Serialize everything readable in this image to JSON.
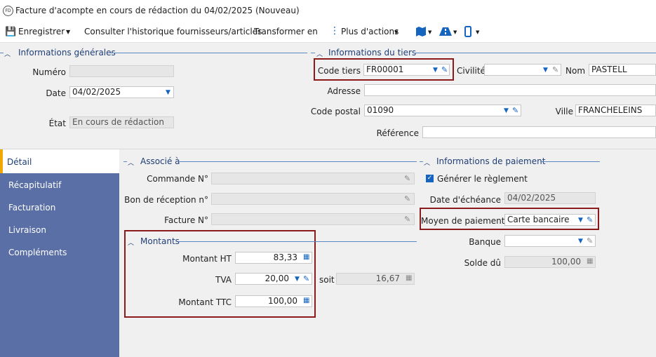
{
  "window": {
    "title": "Facture d'acompte en cours de rédaction du 04/02/2025 (Nouveau)",
    "icon": "fd-badge-icon"
  },
  "toolbar": {
    "save": "Enregistrer",
    "history": "Consulter l'historique fournisseurs/articles",
    "transform": "Transformer en",
    "more": "Plus d'actions"
  },
  "general": {
    "title": "Informations générales",
    "numero_label": "Numéro",
    "numero_value": "",
    "date_label": "Date",
    "date_value": "04/02/2025",
    "etat_label": "État",
    "etat_value": "En cours de rédaction"
  },
  "tiers": {
    "title": "Informations du tiers",
    "code_label": "Code tiers",
    "code_value": "FR00001",
    "civilite_label": "Civilité",
    "civilite_value": "",
    "nom_label": "Nom",
    "nom_value": "PASTELL",
    "adresse_label": "Adresse",
    "adresse_value": "",
    "cp_label": "Code postal",
    "cp_value": "01090",
    "ville_label": "Ville",
    "ville_value": "FRANCHELEINS",
    "ref_label": "Référence",
    "ref_value": ""
  },
  "nav": {
    "items": [
      "Détail",
      "Récapitulatif",
      "Facturation",
      "Livraison",
      "Compléments"
    ]
  },
  "associe": {
    "title": "Associé à",
    "commande_label": "Commande N°",
    "bon_label": "Bon de réception n°",
    "facture_label": "Facture N°"
  },
  "montants": {
    "title": "Montants",
    "ht_label": "Montant HT",
    "ht_value": "83,33",
    "tva_label": "TVA",
    "tva_value": "20,00",
    "soit_label": "soit",
    "soit_value": "16,67",
    "ttc_label": "Montant TTC",
    "ttc_value": "100,00"
  },
  "paiement": {
    "title": "Informations de paiement",
    "generer_label": "Générer le règlement",
    "generer_checked": true,
    "echeance_label": "Date d'échéance",
    "echeance_value": "04/02/2025",
    "moyen_label": "Moyen de paiement",
    "moyen_value": "Carte bancaire",
    "banque_label": "Banque",
    "banque_value": "",
    "solde_label": "Solde dû",
    "solde_value": "100,00"
  },
  "colors": {
    "accent": "#1565c0",
    "nav_bg": "#5b6fa7",
    "highlight_box": "#8b1a1a",
    "active_marker": "#f0a800"
  }
}
